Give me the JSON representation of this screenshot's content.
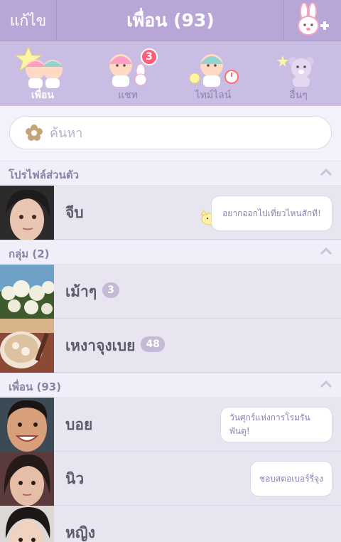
{
  "header": {
    "edit_label": "แก้ไข",
    "title": "เพื่อน (93)",
    "add_friend_icon": "bunny-plus-icon"
  },
  "tabs": [
    {
      "label": "เพื่อน",
      "active": true,
      "icon": "twin-stars-icon"
    },
    {
      "label": "แชท",
      "active": false,
      "icon": "chat-twins-icon",
      "badge": "3"
    },
    {
      "label": "ไทม์ไลน์",
      "active": false,
      "icon": "timeline-twins-icon"
    },
    {
      "label": "อื่นๆ",
      "active": false,
      "icon": "teddy-bear-icon"
    }
  ],
  "search": {
    "placeholder": "ค้นหา",
    "icon": "flower-icon"
  },
  "sections": {
    "profile": {
      "label": "โปรไฟล์ส่วนตัว"
    },
    "groups": {
      "label": "กลุ่ม (2)"
    },
    "friends": {
      "label": "เพื่อน (93)"
    }
  },
  "profile": {
    "name": "จีบ",
    "status": "อยากออกไปเที่ยวไหนสักที!"
  },
  "groups": [
    {
      "name": "เม้าๆ",
      "count": "3"
    },
    {
      "name": "เหงาจุงเบย",
      "count": "48"
    }
  ],
  "friends": [
    {
      "name": "บอย",
      "status": "วันศุกร์แห่งการโรมรันพันตู!"
    },
    {
      "name": "นิว",
      "status": "ชอบสตอเบอร์รี่จุง"
    },
    {
      "name": "หญิง",
      "status": ""
    }
  ],
  "colors": {
    "header": "#b8a7d6",
    "tabs": "#c9bde4",
    "badge": "#ff5d7a"
  }
}
